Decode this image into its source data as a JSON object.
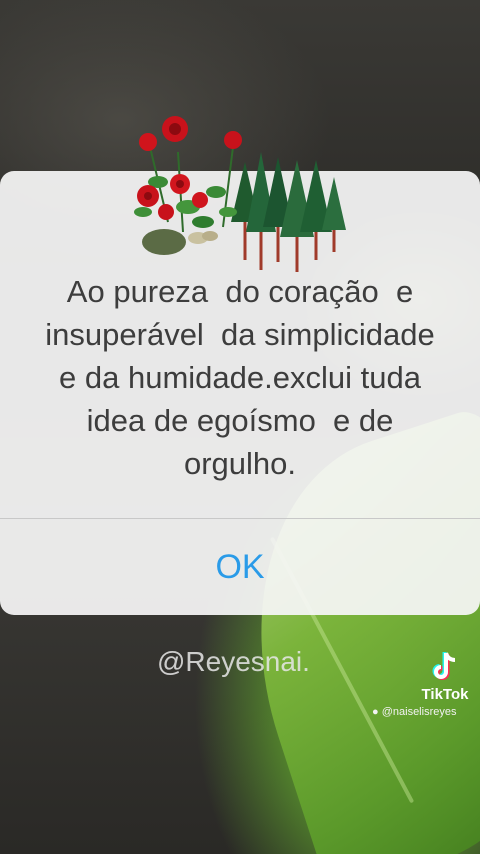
{
  "dialog": {
    "message_lines": [
      "Ao pureza  do coração  e",
      "insuperável  da simplicidade",
      "e da humidade.exclui tuda",
      "idea de egoísmo  e de",
      "orgulho."
    ],
    "ok_label": "OK"
  },
  "overlay": {
    "username": "@Reyesnai.",
    "brand": "TikTok",
    "handle": "@naiselisreyes"
  },
  "icons": {
    "illustration": "roses-and-pine-trees",
    "watermark": "tiktok-note-icon",
    "handle_icon": "person-icon"
  },
  "colors": {
    "accent": "#2a9be8",
    "dialog_bg": "#f6f6f6",
    "text": "#3d3d3d"
  }
}
